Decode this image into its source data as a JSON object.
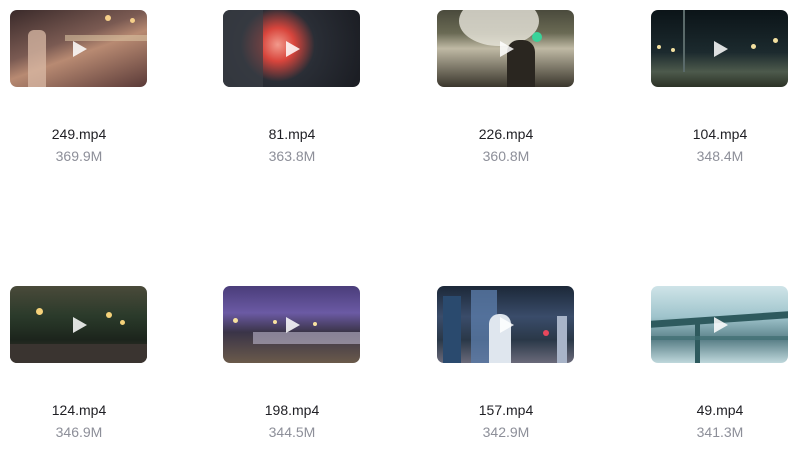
{
  "files": [
    {
      "name": "249.mp4",
      "size": "369.9M"
    },
    {
      "name": "81.mp4",
      "size": "363.8M"
    },
    {
      "name": "226.mp4",
      "size": "360.8M"
    },
    {
      "name": "104.mp4",
      "size": "348.4M"
    },
    {
      "name": "124.mp4",
      "size": "346.9M"
    },
    {
      "name": "198.mp4",
      "size": "344.5M"
    },
    {
      "name": "157.mp4",
      "size": "342.9M"
    },
    {
      "name": "49.mp4",
      "size": "341.3M"
    }
  ],
  "icons": {
    "play": "play-icon"
  },
  "colors": {
    "name_text": "#1f1f24",
    "size_text": "#8d8f99",
    "background": "#ffffff"
  }
}
